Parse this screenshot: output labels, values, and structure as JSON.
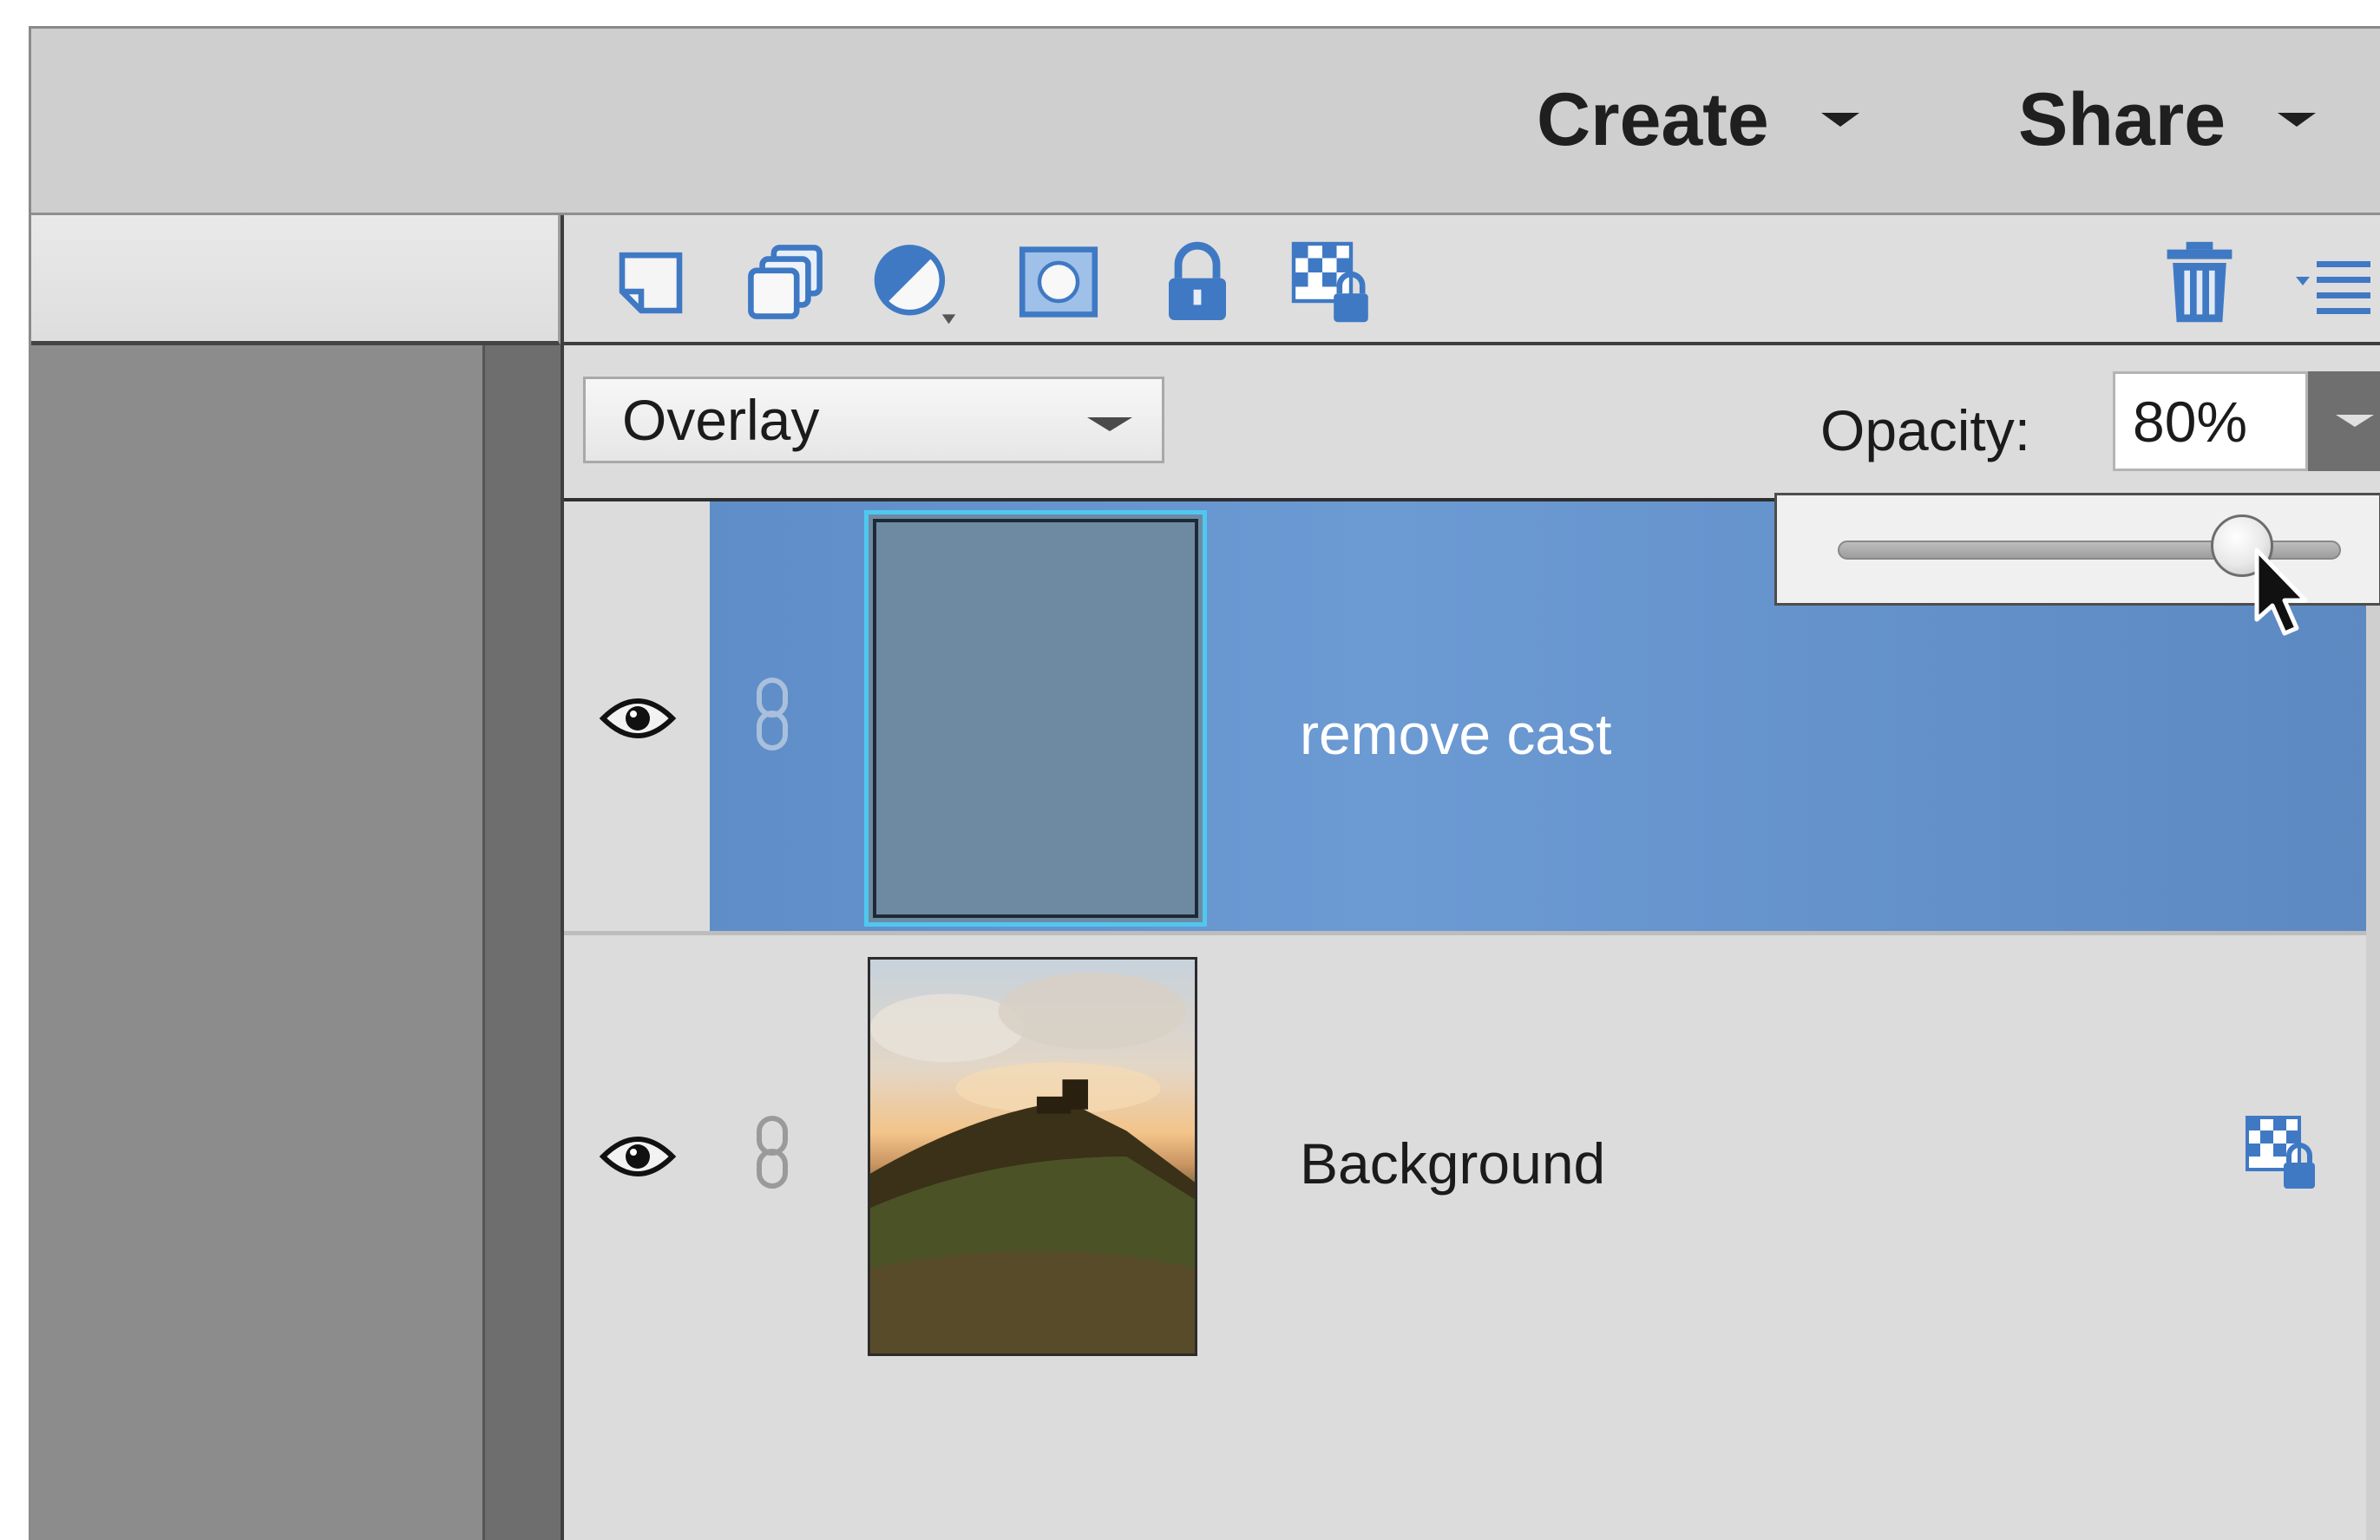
{
  "header": {
    "create_label": "Create",
    "share_label": "Share"
  },
  "toolbar": {
    "icons": [
      "new-layer-icon",
      "new-group-icon",
      "adjustment-layer-icon",
      "layer-mask-icon",
      "lock-all-icon",
      "lock-transparency-icon",
      "trash-icon",
      "panel-menu-icon"
    ]
  },
  "blend": {
    "mode": "Overlay",
    "opacity_label": "Opacity:",
    "opacity_value": "80%",
    "opacity_slider": 0.8
  },
  "layers": [
    {
      "name": "remove cast",
      "selected": true,
      "visible": true
    },
    {
      "name": "Background",
      "selected": false,
      "visible": true,
      "locked": true
    }
  ],
  "colors": {
    "selection": "#6c9ad3",
    "thumbnail_fill": "#6e8aa2",
    "thumbnail_border": "#4fc8f0",
    "icon_blue": "#3f79c4"
  }
}
